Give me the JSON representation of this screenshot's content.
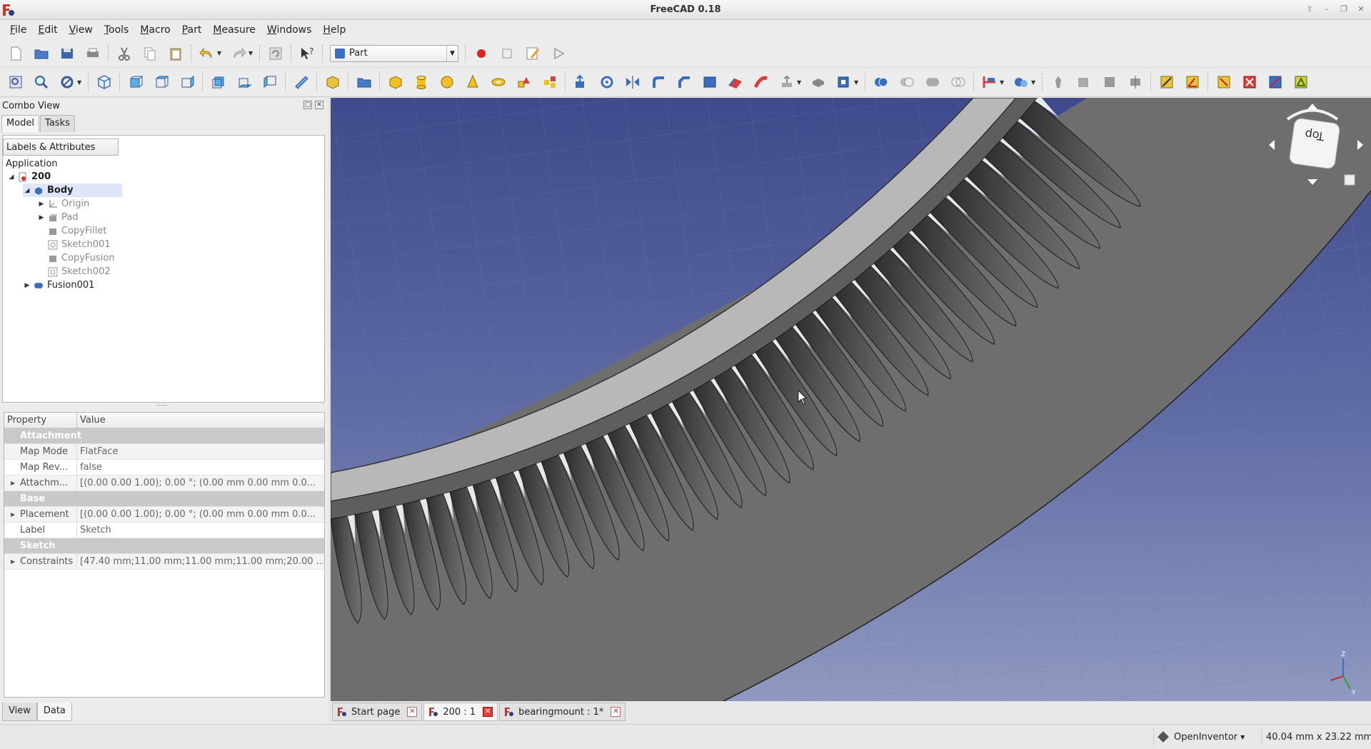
{
  "window": {
    "title": "FreeCAD 0.18"
  },
  "menu": [
    "File",
    "Edit",
    "View",
    "Tools",
    "Macro",
    "Part",
    "Measure",
    "Windows",
    "Help"
  ],
  "workbench": {
    "selected": "Part"
  },
  "combo": {
    "title": "Combo View",
    "tabs": [
      "Model",
      "Tasks"
    ],
    "tree_header": "Labels & Attributes",
    "tree": {
      "root": "Application",
      "doc": "200",
      "body": "Body",
      "children": [
        "Origin",
        "Pad",
        "CopyFillet",
        "Sketch001",
        "CopyFusion",
        "Sketch002"
      ],
      "fusion": "Fusion001"
    },
    "props": {
      "col_property": "Property",
      "col_value": "Value",
      "group_attachment": "Attachment",
      "map_mode_name": "Map Mode",
      "map_mode_value": "FlatFace",
      "map_rev_name": "Map Rev...",
      "map_rev_value": "false",
      "attach_name": "Attachm...",
      "attach_value": "[(0.00 0.00 1.00); 0.00 °; (0.00 mm  0.00 mm  0.0...",
      "group_base": "Base",
      "placement_name": "Placement",
      "placement_value": "[(0.00 0.00 1.00); 0.00 °; (0.00 mm  0.00 mm  0.0...",
      "label_name": "Label",
      "label_value": "Sketch",
      "group_sketch": "Sketch",
      "constraints_name": "Constraints",
      "constraints_value": "[47.40 mm;11.00 mm;11.00 mm;11.00 mm;20.00 ..."
    },
    "bottom_tabs": [
      "View",
      "Data"
    ]
  },
  "navcube": {
    "face": "Top"
  },
  "doc_tabs": [
    "Start page",
    "200 : 1",
    "bearingmount : 1*"
  ],
  "status": {
    "nav_style": "OpenInventor",
    "dimensions": "40.04 mm x 23.22 mm"
  },
  "colors": {
    "bg_top": "#3f4a8c",
    "bg_bottom": "#8f99c0",
    "gear": "#5a5a5a",
    "accent": "#e04040"
  }
}
